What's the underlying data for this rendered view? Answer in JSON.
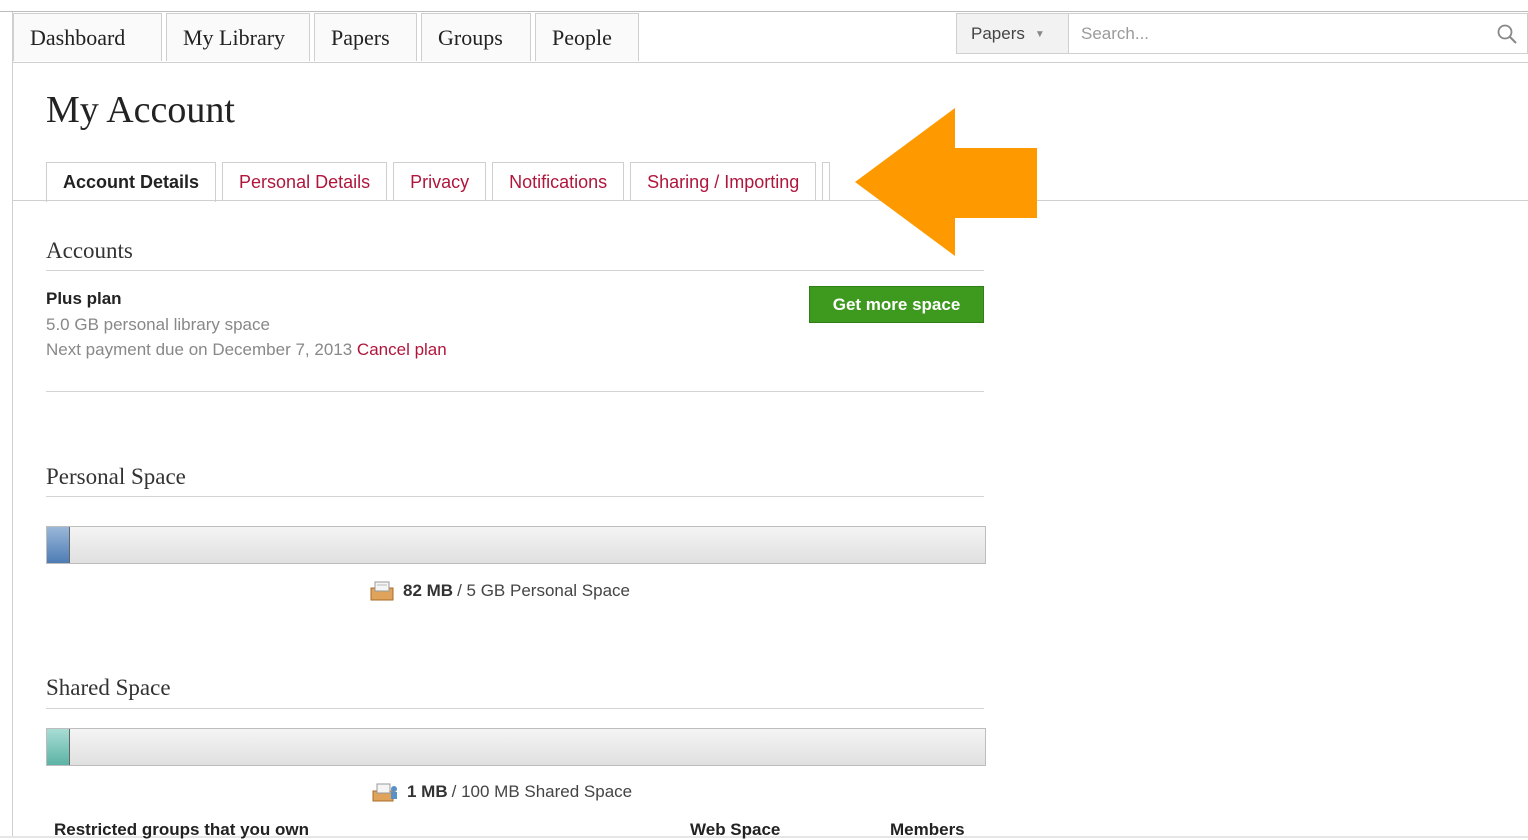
{
  "nav": {
    "tabs": [
      "Dashboard",
      "My Library",
      "Papers",
      "Groups",
      "People"
    ]
  },
  "search": {
    "scope": "Papers",
    "placeholder": "Search..."
  },
  "page": {
    "title": "My Account"
  },
  "subtabs": [
    "Account Details",
    "Personal Details",
    "Privacy",
    "Notifications",
    "Sharing / Importing"
  ],
  "annotation": {
    "arrow_color": "#ff9900"
  },
  "accounts": {
    "heading": "Accounts",
    "plan_name": "Plus plan",
    "plan_space": "5.0 GB personal library space",
    "next_payment": "Next payment due on December 7, 2013",
    "cancel_link": "Cancel plan",
    "get_more_button": "Get more space"
  },
  "personal_space": {
    "heading": "Personal Space",
    "used": "82 MB",
    "total_text": "/ 5 GB Personal Space",
    "fill_fraction": 0.023
  },
  "shared_space": {
    "heading": "Shared Space",
    "used": "1 MB",
    "total_text": "/ 100 MB Shared Space",
    "fill_fraction": 0.023
  },
  "groups_table": {
    "headers": [
      "Restricted groups that you own",
      "Web Space",
      "Members"
    ]
  },
  "colors": {
    "link": "#b0163c",
    "button_green": "#3d9a1f",
    "personal_bar": "#4d7cb4",
    "shared_bar": "#5cb3a5"
  }
}
